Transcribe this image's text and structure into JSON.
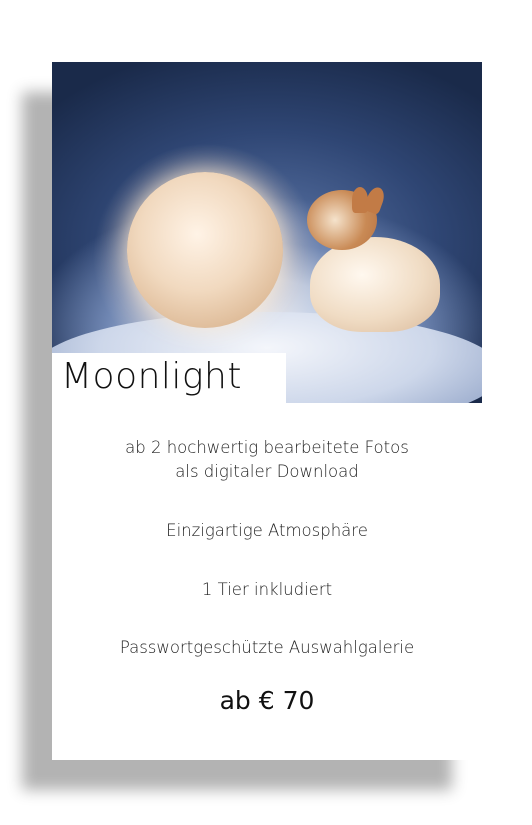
{
  "card": {
    "title": "Moonlight",
    "image": "moon-and-pomeranian-in-snow-photo",
    "features": [
      "ab 2 hochwertig bearbeitete Fotos",
      "als digitaler Download",
      "Einzigartige Atmosphäre",
      "1 Tier inkludiert",
      "Passwortgeschützte Auswahlgalerie"
    ],
    "price": "ab € 70"
  }
}
